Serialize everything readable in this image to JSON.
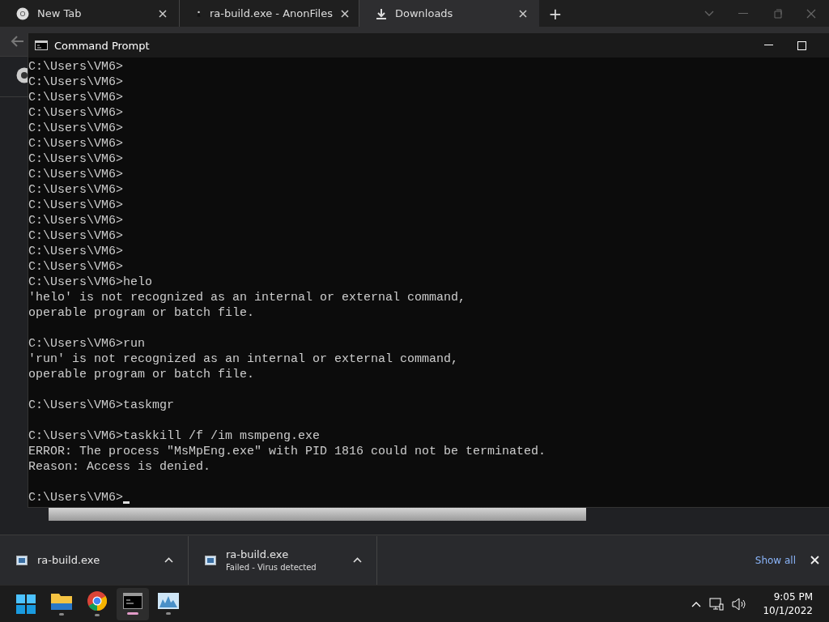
{
  "browser": {
    "tabs": [
      {
        "kind": "chrome",
        "title": "New Tab",
        "selected": false
      },
      {
        "kind": "file",
        "title": "ra-build.exe - AnonFiles",
        "selected": false
      },
      {
        "kind": "download",
        "title": "Downloads",
        "selected": true
      }
    ],
    "new_tab": "+"
  },
  "console": {
    "title": "Command Prompt",
    "cursor": true,
    "lines": [
      {
        "kind": "line",
        "text": "C:\\Users\\VM6>"
      },
      {
        "kind": "line",
        "text": "C:\\Users\\VM6>"
      },
      {
        "kind": "line",
        "text": "C:\\Users\\VM6>"
      },
      {
        "kind": "line",
        "text": "C:\\Users\\VM6>"
      },
      {
        "kind": "line",
        "text": "C:\\Users\\VM6>"
      },
      {
        "kind": "line",
        "text": "C:\\Users\\VM6>"
      },
      {
        "kind": "line",
        "text": "C:\\Users\\VM6>"
      },
      {
        "kind": "line",
        "text": "C:\\Users\\VM6>"
      },
      {
        "kind": "line",
        "text": "C:\\Users\\VM6>"
      },
      {
        "kind": "line",
        "text": "C:\\Users\\VM6>"
      },
      {
        "kind": "line",
        "text": "C:\\Users\\VM6>"
      },
      {
        "kind": "line",
        "text": "C:\\Users\\VM6>"
      },
      {
        "kind": "line",
        "text": "C:\\Users\\VM6>"
      },
      {
        "kind": "line",
        "text": "C:\\Users\\VM6>"
      },
      {
        "kind": "line",
        "text": "C:\\Users\\VM6>helo"
      },
      {
        "kind": "line",
        "text": "'helo' is not recognized as an internal or external command,"
      },
      {
        "kind": "line",
        "text": "operable program or batch file."
      },
      {
        "kind": "blank"
      },
      {
        "kind": "line",
        "text": "C:\\Users\\VM6>run"
      },
      {
        "kind": "line",
        "text": "'run' is not recognized as an internal or external command,"
      },
      {
        "kind": "line",
        "text": "operable program or batch file."
      },
      {
        "kind": "blank"
      },
      {
        "kind": "line",
        "text": "C:\\Users\\VM6>taskmgr"
      },
      {
        "kind": "blank"
      },
      {
        "kind": "line",
        "text": "C:\\Users\\VM6>taskkill /f /im msmpeng.exe"
      },
      {
        "kind": "line",
        "text": "ERROR: The process \"MsMpEng.exe\" with PID 1816 could not be terminated."
      },
      {
        "kind": "line",
        "text": "Reason: Access is denied."
      },
      {
        "kind": "blank"
      },
      {
        "kind": "line",
        "text": "C:\\Users\\VM6>"
      }
    ]
  },
  "downloads": {
    "items": [
      {
        "name": "ra-build.exe"
      },
      {
        "name": "ra-build.exe",
        "status": "Failed - Virus detected"
      }
    ],
    "show_all": "Show all"
  },
  "taskbar": {
    "apps": [
      {
        "kind": "start",
        "running": false,
        "active": false
      },
      {
        "kind": "folder",
        "running": true,
        "active": false
      },
      {
        "kind": "chrome",
        "running": true,
        "active": false
      },
      {
        "kind": "terminal",
        "running": true,
        "active": true
      },
      {
        "kind": "monitor",
        "running": true,
        "active": false
      }
    ],
    "time": "9:05 PM",
    "date": "10/1/2022"
  }
}
